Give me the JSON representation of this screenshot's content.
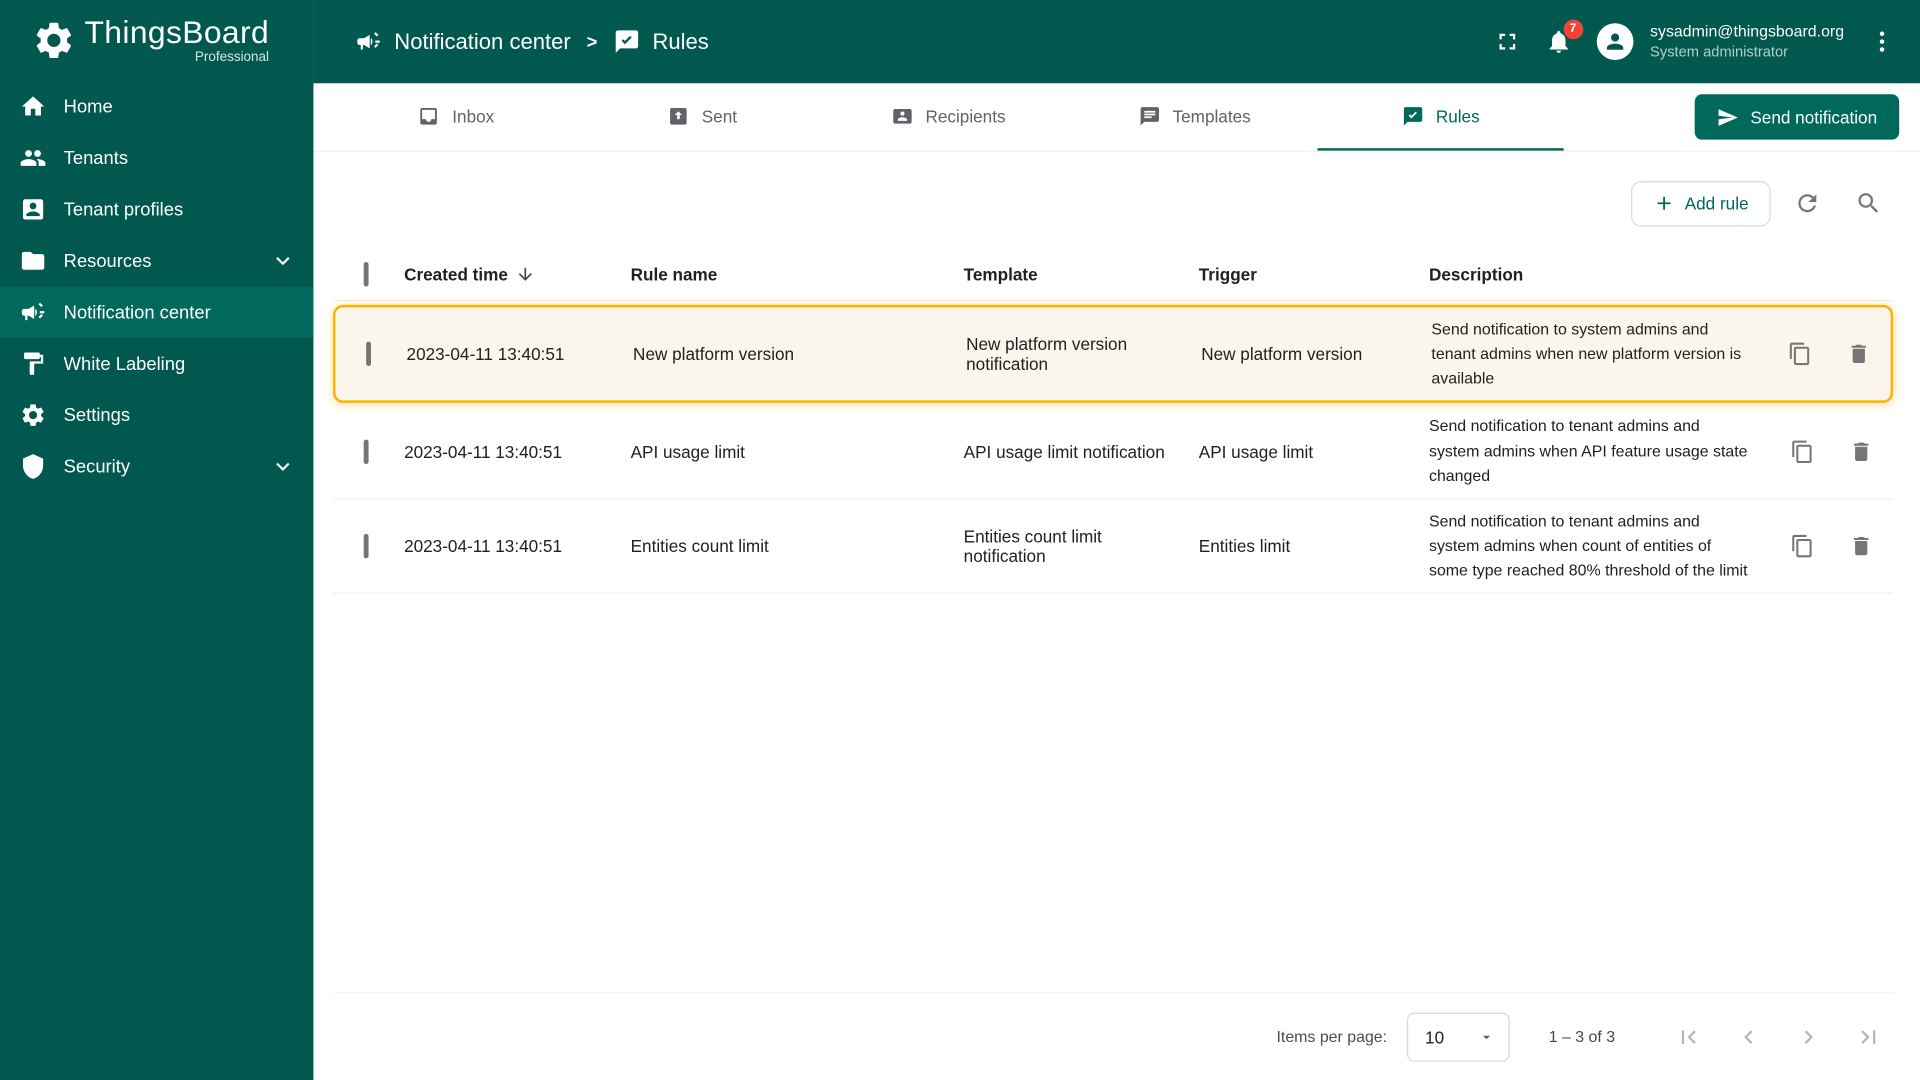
{
  "theme": {
    "primary": "#00584E",
    "primary_light": "#00695C",
    "highlight": "#FFB300",
    "badge_red": "#F44336"
  },
  "brand": {
    "name": "ThingsBoard",
    "edition": "Professional",
    "logo_icon": "gear-logo-icon"
  },
  "sidebar": {
    "items": [
      {
        "label": "Home",
        "icon": "home-icon"
      },
      {
        "label": "Tenants",
        "icon": "people-icon"
      },
      {
        "label": "Tenant profiles",
        "icon": "profile-card-icon"
      },
      {
        "label": "Resources",
        "icon": "folder-icon",
        "expandable": true
      },
      {
        "label": "Notification center",
        "icon": "megaphone-icon",
        "active": true
      },
      {
        "label": "White Labeling",
        "icon": "paint-icon"
      },
      {
        "label": "Settings",
        "icon": "gear-icon"
      },
      {
        "label": "Security",
        "icon": "shield-icon",
        "expandable": true
      }
    ]
  },
  "header": {
    "breadcrumb": {
      "parent": "Notification center",
      "separator": ">",
      "current": "Rules"
    },
    "notifications_badge": "7",
    "user": {
      "email": "sysadmin@thingsboard.org",
      "role": "System administrator"
    }
  },
  "tabs": {
    "items": [
      {
        "label": "Inbox",
        "icon": "inbox-icon"
      },
      {
        "label": "Sent",
        "icon": "outbox-icon"
      },
      {
        "label": "Recipients",
        "icon": "contacts-icon"
      },
      {
        "label": "Templates",
        "icon": "message-icon"
      },
      {
        "label": "Rules",
        "icon": "rule-icon",
        "active": true
      }
    ]
  },
  "toolbar": {
    "send_notification_label": "Send notification",
    "add_rule_label": "Add rule"
  },
  "table": {
    "headers": {
      "created_time": "Created time",
      "rule_name": "Rule name",
      "template": "Template",
      "trigger": "Trigger",
      "description": "Description"
    },
    "rows": [
      {
        "created_time": "2023-04-11 13:40:51",
        "rule_name": "New platform version",
        "template": "New platform version notification",
        "trigger": "New platform version",
        "description": "Send notification to system admins and tenant admins when new platform version is available",
        "highlighted": true
      },
      {
        "created_time": "2023-04-11 13:40:51",
        "rule_name": "API usage limit",
        "template": "API usage limit notification",
        "trigger": "API usage limit",
        "description": "Send notification to tenant admins and system admins when API feature usage state changed",
        "highlighted": false
      },
      {
        "created_time": "2023-04-11 13:40:51",
        "rule_name": "Entities count limit",
        "template": "Entities count limit notification",
        "trigger": "Entities limit",
        "description": "Send notification to tenant admins and system admins when count of entities of some type reached 80% threshold of the limit",
        "highlighted": false
      }
    ]
  },
  "paginator": {
    "items_per_page_label": "Items per page:",
    "page_size": "10",
    "range_label": "1 – 3 of 3"
  }
}
